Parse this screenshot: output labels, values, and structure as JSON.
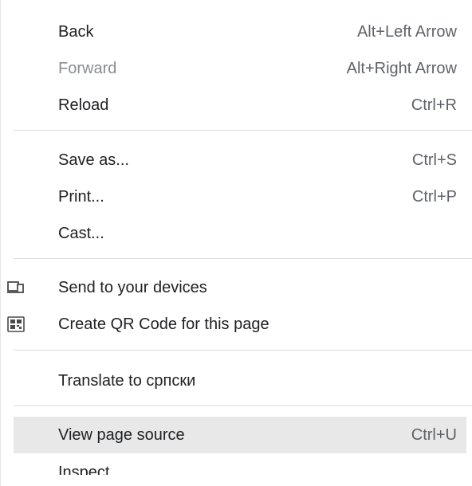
{
  "menu": {
    "back": {
      "label": "Back",
      "shortcut": "Alt+Left Arrow"
    },
    "forward": {
      "label": "Forward",
      "shortcut": "Alt+Right Arrow"
    },
    "reload": {
      "label": "Reload",
      "shortcut": "Ctrl+R"
    },
    "save_as": {
      "label": "Save as...",
      "shortcut": "Ctrl+S"
    },
    "print": {
      "label": "Print...",
      "shortcut": "Ctrl+P"
    },
    "cast": {
      "label": "Cast..."
    },
    "send_to_devices": {
      "label": "Send to your devices",
      "icon": "devices-icon"
    },
    "create_qr": {
      "label": "Create QR Code for this page",
      "icon": "qr-code-icon"
    },
    "translate": {
      "label": "Translate to српски"
    },
    "view_source": {
      "label": "View page source",
      "shortcut": "Ctrl+U"
    },
    "inspect": {
      "label": "Inspect"
    }
  }
}
